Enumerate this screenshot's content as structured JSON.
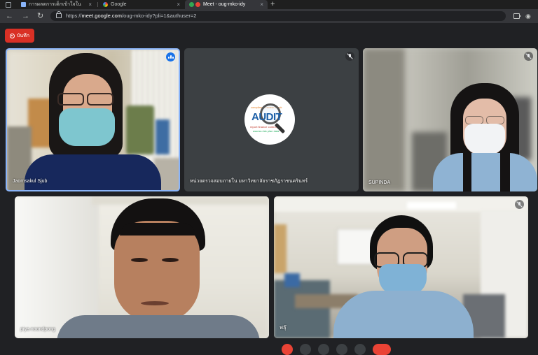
{
  "browser": {
    "tabs": [
      {
        "title": "การผลตการเด็กเข้าใจใน",
        "active": false
      },
      {
        "title": "Google",
        "active": false
      },
      {
        "title": "Meet - oug-mko-idy",
        "active": true
      }
    ],
    "url_prefix": "https://",
    "url_host": "meet.google.com",
    "url_path": "/oug-mko-idy?pli=1&authuser=2",
    "new_tab": "+",
    "close_glyph": "×"
  },
  "meet": {
    "record_label": "บันทึก",
    "participants": [
      {
        "name": "Jaomsakul Sjub",
        "state": "speaking"
      },
      {
        "name": "หน่วยตรวจสอบภายใน มหาวิทยาลัยราชภัฏราชนครินทร์",
        "state": "muted",
        "avatar_text": "AUDIT"
      },
      {
        "name": "SUPINDA",
        "state": "muted"
      },
      {
        "name": "piya noondpong",
        "state": "unmuted"
      },
      {
        "name": "ฟลุ๊",
        "state": "muted"
      }
    ]
  },
  "colors": {
    "accent": "#1a73e8",
    "record": "#d93025",
    "background": "#202124"
  }
}
